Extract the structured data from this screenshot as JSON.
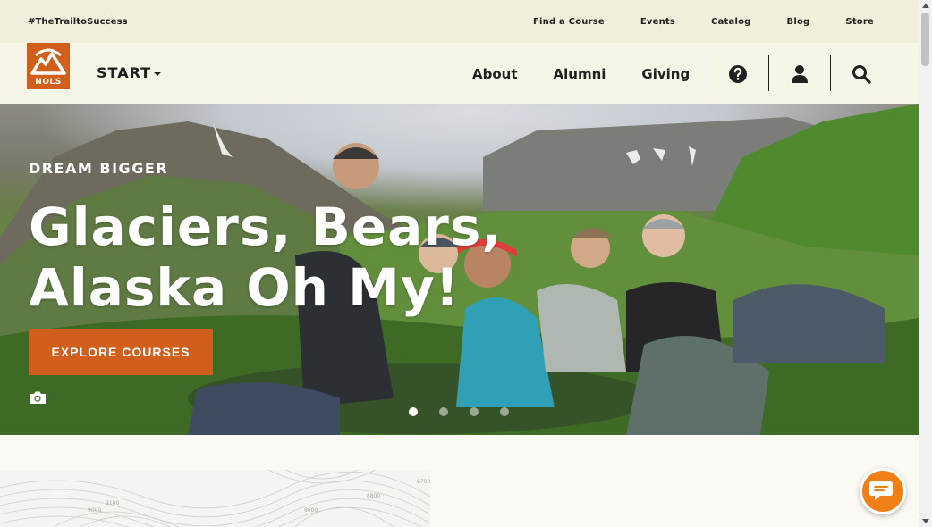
{
  "utility_bar": {
    "hashtag": "#TheTrailtoSuccess",
    "links": [
      "Find a Course",
      "Events",
      "Catalog",
      "Blog",
      "Store"
    ]
  },
  "brand": {
    "logo_text": "NOLS",
    "start_label": "START"
  },
  "nav": {
    "links": [
      "About",
      "Alumni",
      "Giving"
    ],
    "icons": [
      "help-icon",
      "account-icon",
      "search-icon"
    ]
  },
  "hero": {
    "eyebrow": "DREAM BIGGER",
    "title_line1": "Glaciers, Bears,",
    "title_line2": "Alaska Oh My!",
    "cta_label": "EXPLORE COURSES",
    "slide_count": 4,
    "active_slide": 1
  },
  "topo_labels": [
    "9000",
    "9100",
    "8800",
    "8700",
    "8600"
  ],
  "colors": {
    "accent": "#d15e1a",
    "utility_bg": "#f1efdb",
    "nav_bg": "#f7f5e8",
    "chat": "#f07f16"
  }
}
